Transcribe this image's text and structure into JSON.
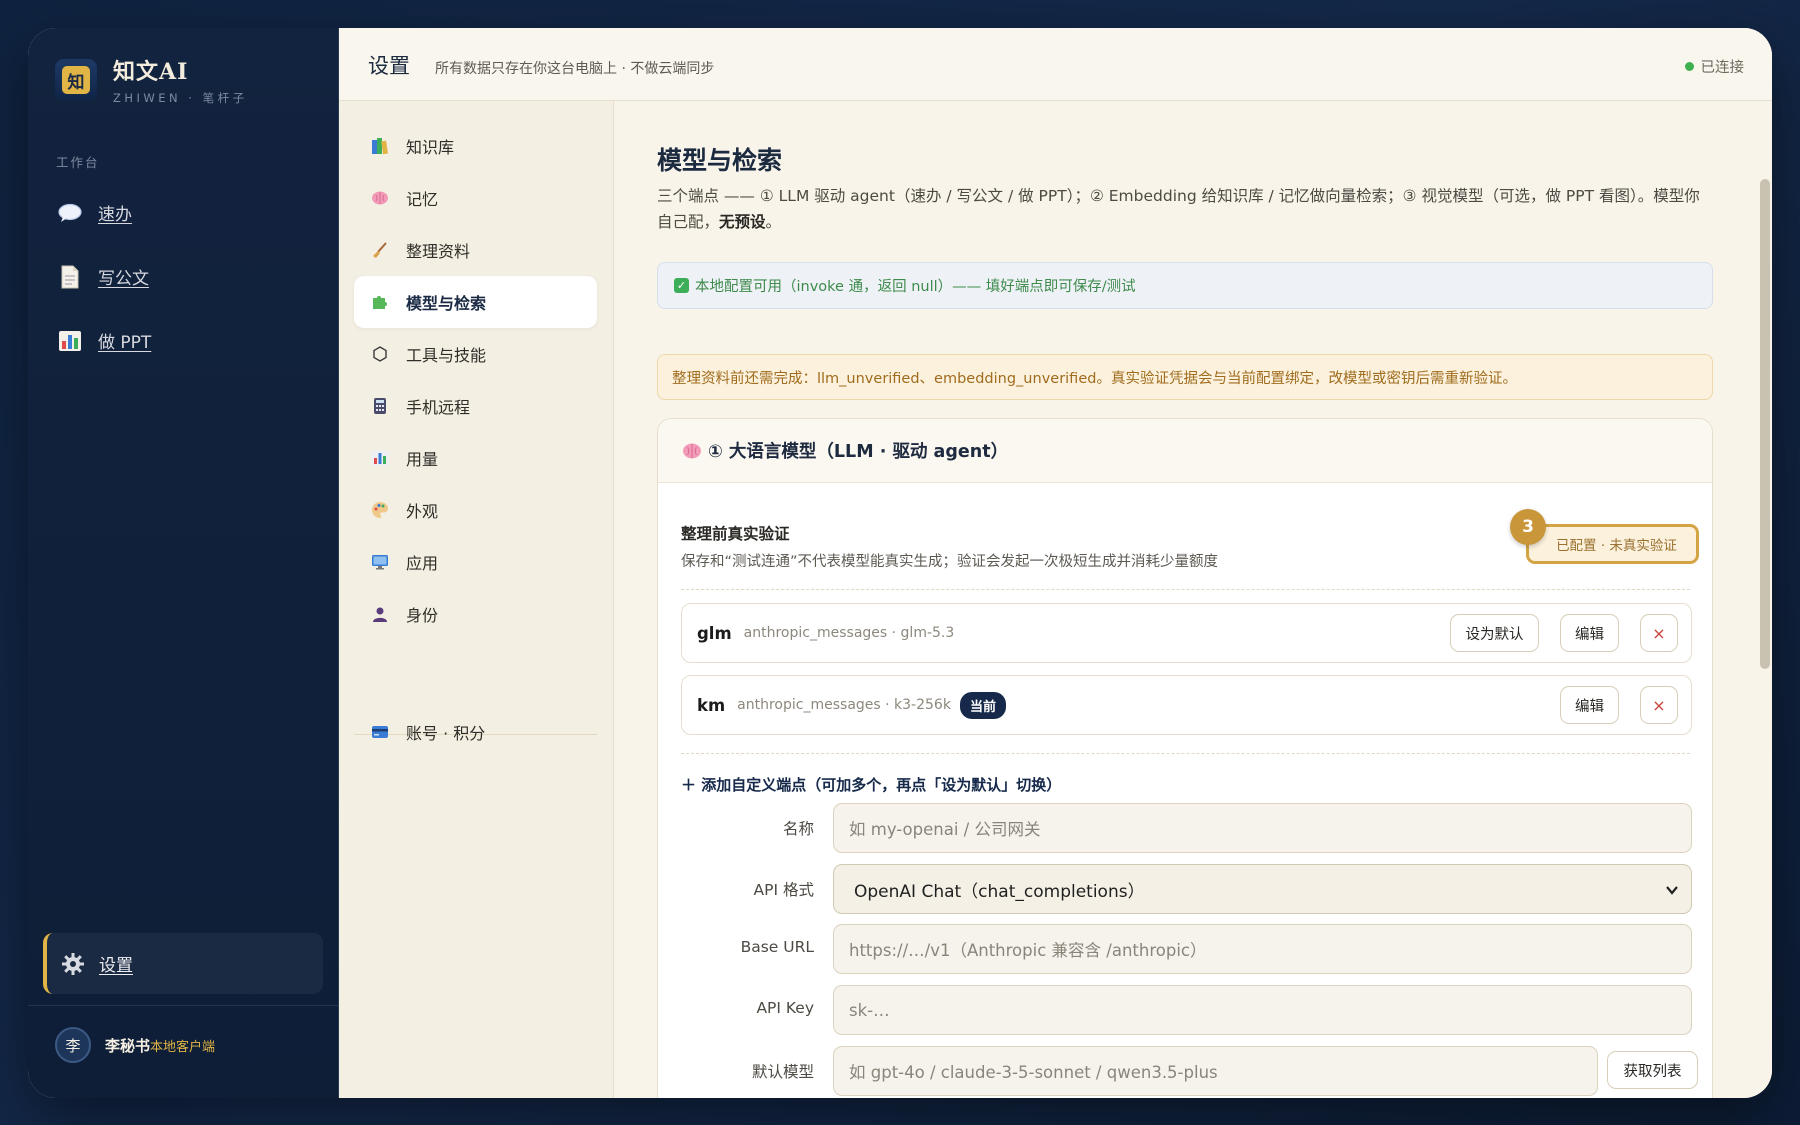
{
  "app": {
    "name": "知文AI",
    "subtitle": "ZHIWEN · 笔杆子",
    "logo_char": "知",
    "section_label": "工作台"
  },
  "sidebar": {
    "items": [
      {
        "label": "速办",
        "icon": "speech-bubble-icon"
      },
      {
        "label": "写公文",
        "icon": "document-icon"
      },
      {
        "label": "做 PPT",
        "icon": "bar-chart-icon"
      }
    ],
    "settings": {
      "label": "设置",
      "icon": "gear-icon"
    },
    "user": {
      "avatar": "李",
      "name": "李秘书",
      "tag": "本地客户端"
    }
  },
  "topbar": {
    "title": "设置",
    "subtitle": "所有数据只存在你这台电脑上 · 不做云端同步",
    "status": "已连接"
  },
  "subnav": {
    "items": [
      {
        "label": "知识库",
        "icon": "books-icon"
      },
      {
        "label": "记忆",
        "icon": "brain-icon"
      },
      {
        "label": "整理资料",
        "icon": "broom-icon"
      },
      {
        "label": "模型与检索",
        "icon": "puzzle-icon",
        "active": true
      },
      {
        "label": "工具与技能",
        "icon": "hexagon-icon"
      },
      {
        "label": "手机远程",
        "icon": "calculator-icon"
      },
      {
        "label": "用量",
        "icon": "bar-chart-icon"
      },
      {
        "label": "外观",
        "icon": "palette-icon"
      },
      {
        "label": "应用",
        "icon": "monitor-icon"
      },
      {
        "label": "身份",
        "icon": "person-icon"
      }
    ],
    "account": {
      "label": "账号 · 积分",
      "icon": "credit-card-icon"
    }
  },
  "main": {
    "heading": "模型与检索",
    "intro": "三个端点 —— ① LLM 驱动 agent（速办 / 写公文 / 做 PPT）；② Embedding 给知识库 / 记忆做向量检索；③ 视觉模型（可选，做 PPT 看图）。模型你自己配，",
    "intro_bold": "无预设",
    "intro_end": "。",
    "alert_ok": "本地配置可用（invoke 通，返回 null）—— 填好端点即可保存/测试",
    "alert_warn": "整理资料前还需完成：llm_unverified、embedding_unverified。真实验证凭据会与当前配置绑定，改模型或密钥后需重新验证。",
    "llm_card": {
      "title": "① 大语言模型（LLM · 驱动 agent）",
      "icon": "brain-icon",
      "verify_title": "整理前真实验证",
      "verify_desc": "保存和“测试连通”不代表模型能真实生成；验证会发起一次极短生成并消耗少量额度",
      "badge_number": "3",
      "status": "已配置 · 未真实验证",
      "endpoints": [
        {
          "name": "glm",
          "meta": "anthropic_messages · glm-5.3",
          "set_default": "设为默认",
          "edit": "编辑",
          "delete": "×"
        },
        {
          "name": "km",
          "meta": "anthropic_messages · k3-256k",
          "current": "当前",
          "edit": "编辑",
          "delete": "×"
        }
      ],
      "add_label": "添加自定义端点（可加多个，再点「设为默认」切换）",
      "form": {
        "name_label": "名称",
        "name_placeholder": "如 my-openai / 公司网关",
        "format_label": "API 格式",
        "format_value": "OpenAI Chat（chat_completions）",
        "base_url_label": "Base URL",
        "base_url_placeholder": "https://…/v1（Anthropic 兼容含 /anthropic）",
        "api_key_label": "API Key",
        "api_key_placeholder": "sk-…",
        "model_label": "默认模型",
        "model_placeholder": "如 gpt-4o / claude-3-5-sonnet / qwen3.5-plus",
        "fetch_label": "获取列表"
      }
    }
  },
  "colors": {
    "accent": "#e0b445",
    "navy": "#16294a",
    "ok": "#3cae59",
    "warn": "#a06c1e"
  }
}
